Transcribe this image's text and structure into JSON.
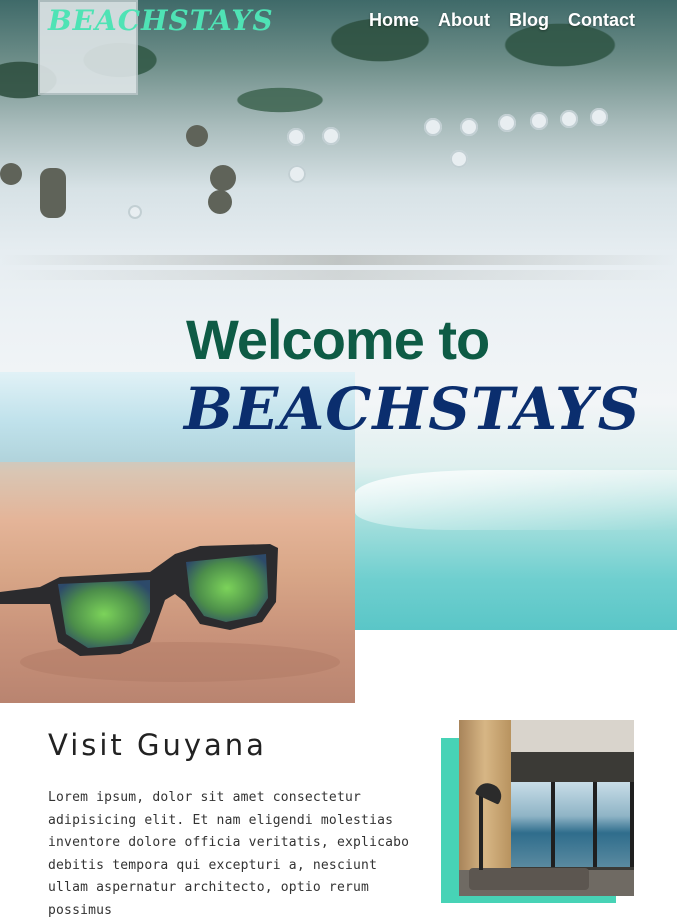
{
  "header": {
    "logo": "BEACHSTAYS",
    "nav": [
      "Home",
      "About",
      "Blog",
      "Contact"
    ]
  },
  "hero": {
    "welcome": "Welcome to",
    "brand": "BEACHSTAYS"
  },
  "visit": {
    "title": "Visit Guyana",
    "paragraph": "Lorem ipsum, dolor sit amet consectetur adipisicing elit. Et nam eligendi molestias inventore dolore officia veritatis, explicabo debitis tempora qui excepturi a, nesciunt ullam aspernatur architecto, optio rerum possimus"
  },
  "colors": {
    "logo": "#4fe3b5",
    "welcome": "#0e5b45",
    "brand": "#0b2e6e",
    "accent": "#47d3b6"
  }
}
